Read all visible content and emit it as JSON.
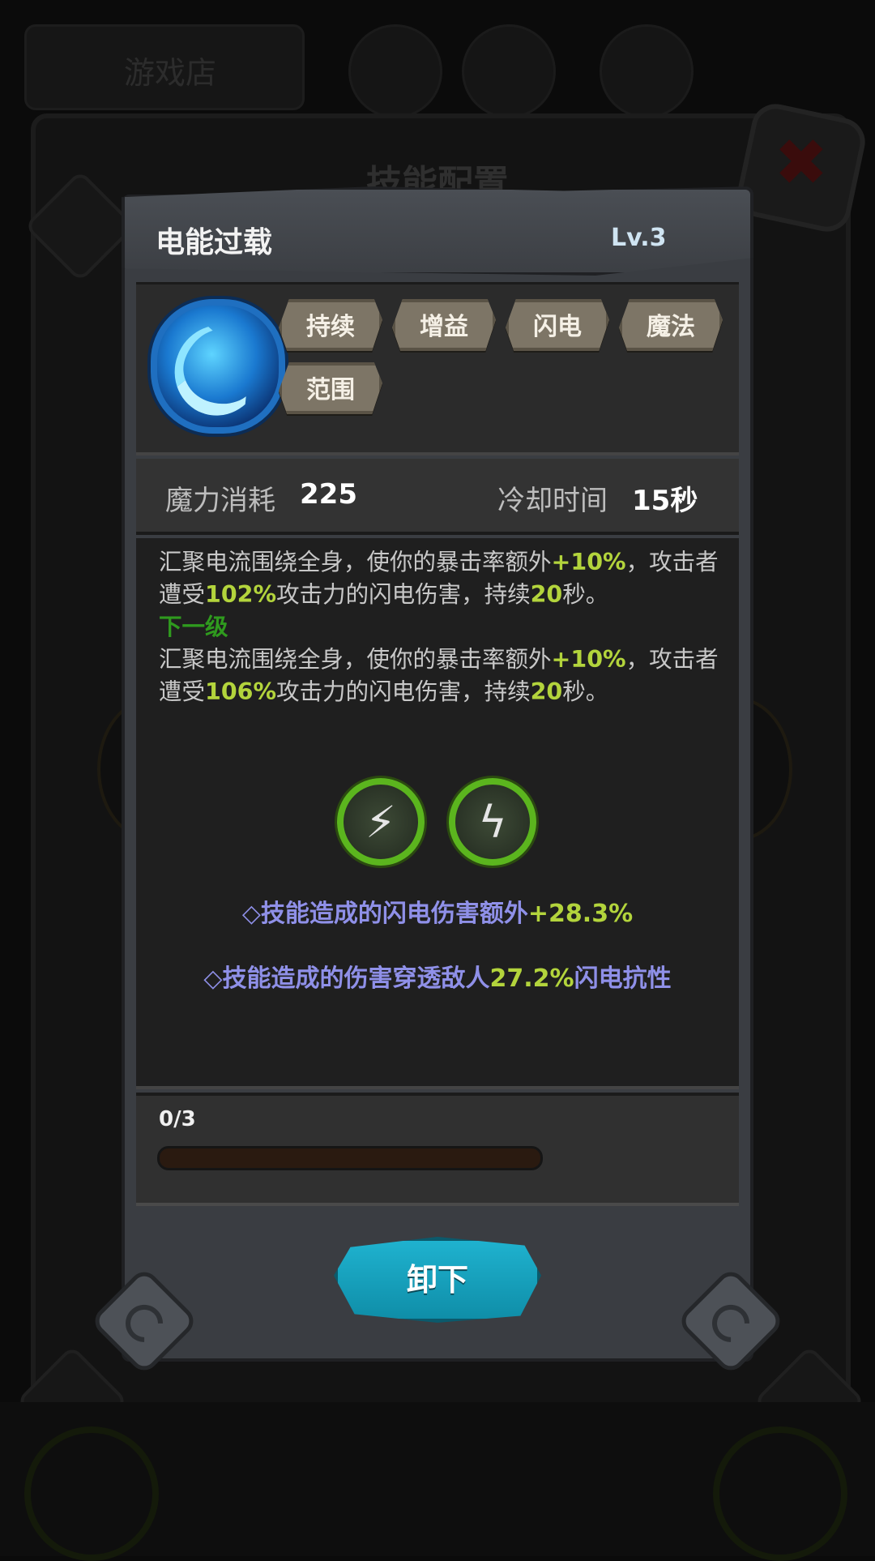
{
  "background": {
    "tab_label": "游戏店",
    "title": "技能配置",
    "close_icon": "close-x-icon"
  },
  "skill": {
    "name": "电能过载",
    "level": "Lv.3",
    "icon": "lightning-orb-icon",
    "tags": [
      "持续",
      "增益",
      "闪电",
      "魔法",
      "范围"
    ]
  },
  "stats": {
    "mana_label": "魔力消耗",
    "mana_value": "225",
    "cooldown_label": "冷却时间",
    "cooldown_value": "15秒"
  },
  "description": {
    "current": {
      "p1": "汇聚电流围绕全身，使你的暴击率额外",
      "crit": "+10%",
      "p2": "，攻击者遭受",
      "dmg": "102%",
      "p3": "攻击力的闪电伤害，持续",
      "dur": "20",
      "p4": "秒。"
    },
    "next_label": "下一级",
    "next": {
      "p1": "汇聚电流围绕全身，使你的暴击率额外",
      "crit": "+10%",
      "p2": "，攻击者遭受",
      "dmg": "106%",
      "p3": "攻击力的闪电伤害，持续",
      "dur": "20",
      "p4": "秒。"
    }
  },
  "runes": [
    {
      "icon": "lightning-bolt-icon"
    },
    {
      "icon": "shattered-lightning-icon"
    }
  ],
  "bonuses": [
    {
      "prefix": "◇技能造成的闪电伤害额外",
      "value": "+28.3%",
      "suffix": ""
    },
    {
      "prefix": "◇技能造成的伤害穿透敌人",
      "value": "27.2%",
      "suffix": "闪电抗性"
    }
  ],
  "progress": {
    "text": "0/3",
    "fraction": 0
  },
  "actions": {
    "unequip_label": "卸下"
  },
  "colors": {
    "highlight": "#b3d43c",
    "next_level": "#2f9a1e",
    "bonus_text": "#8f90e8",
    "button": "#1fb2cf"
  }
}
